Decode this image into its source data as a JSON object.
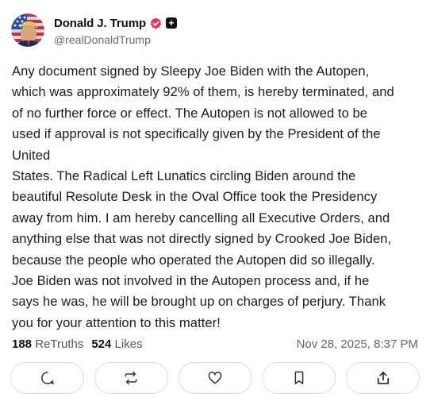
{
  "post": {
    "author": {
      "display_name": "Donald J. Trump",
      "handle": "@realDonaldTrump",
      "verified_icon": "verified-badge-icon",
      "badge_icon": "plus-badge-icon"
    },
    "text": "Any document signed by Sleepy Joe Biden with the Autopen,\nwhich was approximately 92% of them, is hereby terminated, and\nof no further force or effect. The Autopen is not allowed to be\nused if approval is not specifically given by the President of the\nUnited\nStates. The Radical Left Lunatics circling Biden around the\nbeautiful Resolute Desk in the Oval Office took the Presidency\naway from him. I am hereby cancelling all Executive Orders, and\nanything else that was not directly signed by Crooked Joe Biden,\nbecause the people who operated the Autopen did so illegally.\nJoe Biden was not involved in the Autopen process and, if he\nsays he was, he will be brought up on charges of perjury. Thank\nyou for your attention to this matter!",
    "stats": {
      "retruths_count": "188",
      "retruths_label": "ReTruths",
      "likes_count": "524",
      "likes_label": "Likes"
    },
    "timestamp": "Nov 28, 2025, 8:37 PM"
  },
  "actions": [
    "reply-icon",
    "retruth-icon",
    "like-icon",
    "bookmark-icon",
    "share-icon"
  ],
  "colors": {
    "verified": "#e8355a",
    "text": "#1c1c1c",
    "muted": "#6b6b6b",
    "border": "#dcdcdc"
  }
}
